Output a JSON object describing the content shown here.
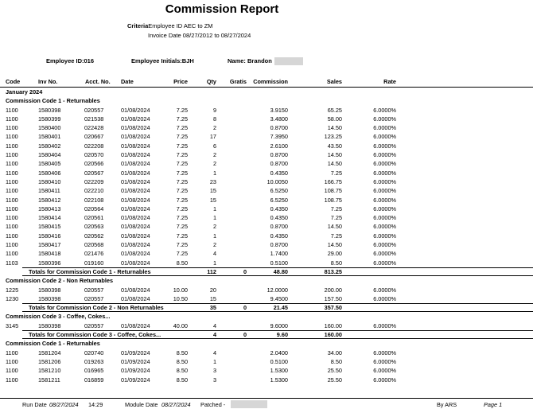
{
  "report": {
    "title": "Commission Report",
    "criteria_label": "Criteria",
    "criteria_value": "Employee ID  AEC  to  ZM",
    "invoice_date": "Invoice Date  08/27/2012  to  08/27/2024"
  },
  "employee": {
    "id_text": "Employee ID:016",
    "initials_text": "Employee Initials:BJH",
    "name_text": "Name: Brandon"
  },
  "columns": [
    "Code",
    "Inv No.",
    "Acct. No.",
    "Date",
    "Price",
    "Qty",
    "Gratis",
    "Commission",
    "Sales",
    "Rate"
  ],
  "rows": [
    {
      "kind": "sec",
      "label": "January 2024"
    },
    {
      "kind": "sec",
      "label": "Commission Code 1 - Returnables"
    },
    {
      "kind": "d",
      "code": "1100",
      "inv": "1580398",
      "acct": "020557",
      "date": "01/08/2024",
      "price": "7.25",
      "qty": "9",
      "gratis": "",
      "comm": "3.9150",
      "sales": "65.25",
      "rate": "6.0000%"
    },
    {
      "kind": "d",
      "code": "1100",
      "inv": "1580399",
      "acct": "021538",
      "date": "01/08/2024",
      "price": "7.25",
      "qty": "8",
      "gratis": "",
      "comm": "3.4800",
      "sales": "58.00",
      "rate": "6.0000%"
    },
    {
      "kind": "d",
      "code": "1100",
      "inv": "1580400",
      "acct": "022428",
      "date": "01/08/2024",
      "price": "7.25",
      "qty": "2",
      "gratis": "",
      "comm": "0.8700",
      "sales": "14.50",
      "rate": "6.0000%"
    },
    {
      "kind": "d",
      "code": "1100",
      "inv": "1580401",
      "acct": "020667",
      "date": "01/08/2024",
      "price": "7.25",
      "qty": "17",
      "gratis": "",
      "comm": "7.3950",
      "sales": "123.25",
      "rate": "6.0000%"
    },
    {
      "kind": "d",
      "code": "1100",
      "inv": "1580402",
      "acct": "022208",
      "date": "01/08/2024",
      "price": "7.25",
      "qty": "6",
      "gratis": "",
      "comm": "2.6100",
      "sales": "43.50",
      "rate": "6.0000%"
    },
    {
      "kind": "d",
      "code": "1100",
      "inv": "1580404",
      "acct": "020570",
      "date": "01/08/2024",
      "price": "7.25",
      "qty": "2",
      "gratis": "",
      "comm": "0.8700",
      "sales": "14.50",
      "rate": "6.0000%"
    },
    {
      "kind": "d",
      "code": "1100",
      "inv": "1580405",
      "acct": "020566",
      "date": "01/08/2024",
      "price": "7.25",
      "qty": "2",
      "gratis": "",
      "comm": "0.8700",
      "sales": "14.50",
      "rate": "6.0000%"
    },
    {
      "kind": "d",
      "code": "1100",
      "inv": "1580406",
      "acct": "020567",
      "date": "01/08/2024",
      "price": "7.25",
      "qty": "1",
      "gratis": "",
      "comm": "0.4350",
      "sales": "7.25",
      "rate": "6.0000%"
    },
    {
      "kind": "d",
      "code": "1100",
      "inv": "1580410",
      "acct": "022209",
      "date": "01/08/2024",
      "price": "7.25",
      "qty": "23",
      "gratis": "",
      "comm": "10.0050",
      "sales": "166.75",
      "rate": "6.0000%"
    },
    {
      "kind": "d",
      "code": "1100",
      "inv": "1580411",
      "acct": "022210",
      "date": "01/08/2024",
      "price": "7.25",
      "qty": "15",
      "gratis": "",
      "comm": "6.5250",
      "sales": "108.75",
      "rate": "6.0000%"
    },
    {
      "kind": "d",
      "code": "1100",
      "inv": "1580412",
      "acct": "022108",
      "date": "01/08/2024",
      "price": "7.25",
      "qty": "15",
      "gratis": "",
      "comm": "6.5250",
      "sales": "108.75",
      "rate": "6.0000%"
    },
    {
      "kind": "d",
      "code": "1100",
      "inv": "1580413",
      "acct": "020564",
      "date": "01/08/2024",
      "price": "7.25",
      "qty": "1",
      "gratis": "",
      "comm": "0.4350",
      "sales": "7.25",
      "rate": "6.0000%"
    },
    {
      "kind": "d",
      "code": "1100",
      "inv": "1580414",
      "acct": "020561",
      "date": "01/08/2024",
      "price": "7.25",
      "qty": "1",
      "gratis": "",
      "comm": "0.4350",
      "sales": "7.25",
      "rate": "6.0000%"
    },
    {
      "kind": "d",
      "code": "1100",
      "inv": "1580415",
      "acct": "020563",
      "date": "01/08/2024",
      "price": "7.25",
      "qty": "2",
      "gratis": "",
      "comm": "0.8700",
      "sales": "14.50",
      "rate": "6.0000%"
    },
    {
      "kind": "d",
      "code": "1100",
      "inv": "1580416",
      "acct": "020562",
      "date": "01/08/2024",
      "price": "7.25",
      "qty": "1",
      "gratis": "",
      "comm": "0.4350",
      "sales": "7.25",
      "rate": "6.0000%"
    },
    {
      "kind": "d",
      "code": "1100",
      "inv": "1580417",
      "acct": "020568",
      "date": "01/08/2024",
      "price": "7.25",
      "qty": "2",
      "gratis": "",
      "comm": "0.8700",
      "sales": "14.50",
      "rate": "6.0000%"
    },
    {
      "kind": "d",
      "code": "1100",
      "inv": "1580418",
      "acct": "021476",
      "date": "01/08/2024",
      "price": "7.25",
      "qty": "4",
      "gratis": "",
      "comm": "1.7400",
      "sales": "29.00",
      "rate": "6.0000%"
    },
    {
      "kind": "d",
      "code": "1103",
      "inv": "1580396",
      "acct": "019160",
      "date": "01/08/2024",
      "price": "8.50",
      "qty": "1",
      "gratis": "",
      "comm": "0.5100",
      "sales": "8.50",
      "rate": "6.0000%"
    },
    {
      "kind": "tot",
      "label": "Totals for Commission Code 1 - Returnables",
      "qty": "112",
      "gratis": "0",
      "comm": "48.80",
      "sales": "813.25"
    },
    {
      "kind": "sec",
      "label": "Commission Code 2 - Non Returnables"
    },
    {
      "kind": "d",
      "code": "1225",
      "inv": "1580398",
      "acct": "020557",
      "date": "01/08/2024",
      "price": "10.00",
      "qty": "20",
      "gratis": "",
      "comm": "12.0000",
      "sales": "200.00",
      "rate": "6.0000%"
    },
    {
      "kind": "d",
      "code": "1230",
      "inv": "1580398",
      "acct": "020557",
      "date": "01/08/2024",
      "price": "10.50",
      "qty": "15",
      "gratis": "",
      "comm": "9.4500",
      "sales": "157.50",
      "rate": "6.0000%"
    },
    {
      "kind": "tot",
      "label": "Totals for Commission Code 2 - Non Returnables",
      "qty": "35",
      "gratis": "0",
      "comm": "21.45",
      "sales": "357.50"
    },
    {
      "kind": "sec",
      "label": "Commission Code 3 - Coffee, Cokes..."
    },
    {
      "kind": "d",
      "code": "3145",
      "inv": "1580398",
      "acct": "020557",
      "date": "01/08/2024",
      "price": "40.00",
      "qty": "4",
      "gratis": "",
      "comm": "9.6000",
      "sales": "160.00",
      "rate": "6.0000%"
    },
    {
      "kind": "tot",
      "label": "Totals for Commission Code 3 - Coffee, Cokes...",
      "qty": "4",
      "gratis": "0",
      "comm": "9.60",
      "sales": "160.00"
    },
    {
      "kind": "sec",
      "label": "Commission Code 1 - Returnables"
    },
    {
      "kind": "d",
      "code": "1100",
      "inv": "1581204",
      "acct": "020740",
      "date": "01/09/2024",
      "price": "8.50",
      "qty": "4",
      "gratis": "",
      "comm": "2.0400",
      "sales": "34.00",
      "rate": "6.0000%"
    },
    {
      "kind": "d",
      "code": "1100",
      "inv": "1581206",
      "acct": "019263",
      "date": "01/09/2024",
      "price": "8.50",
      "qty": "1",
      "gratis": "",
      "comm": "0.5100",
      "sales": "8.50",
      "rate": "6.0000%"
    },
    {
      "kind": "d",
      "code": "1100",
      "inv": "1581210",
      "acct": "016965",
      "date": "01/09/2024",
      "price": "8.50",
      "qty": "3",
      "gratis": "",
      "comm": "1.5300",
      "sales": "25.50",
      "rate": "6.0000%"
    },
    {
      "kind": "d",
      "code": "1100",
      "inv": "1581211",
      "acct": "016859",
      "date": "01/09/2024",
      "price": "8.50",
      "qty": "3",
      "gratis": "",
      "comm": "1.5300",
      "sales": "25.50",
      "rate": "6.0000%"
    }
  ],
  "footer": {
    "run_date_label": "Run Date",
    "run_date": "08/27/2024",
    "run_time": "14:29",
    "module_date_label": "Module Date",
    "module_date": "08/27/2024",
    "patched_label": "Patched -",
    "by": "By ARS",
    "page": "Page 1"
  }
}
